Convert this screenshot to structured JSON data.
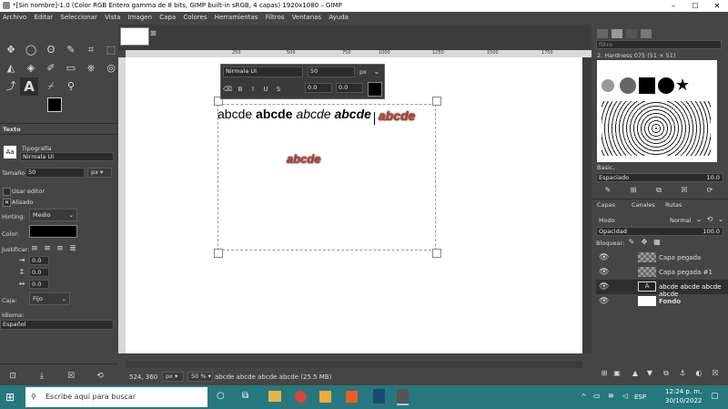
{
  "window": {
    "title": "*[Sin nombre]-1.0 (Color RGB Entero gamma de 8 bits, GIMP built-in sRGB, 4 capas) 1920x1080 – GIMP",
    "controls": [
      "–",
      "☐",
      "✕"
    ]
  },
  "menu": [
    "Archivo",
    "Editar",
    "Seleccionar",
    "Vista",
    "Imagen",
    "Capa",
    "Colores",
    "Herramientas",
    "Filtros",
    "Ventanas",
    "Ayuda"
  ],
  "tool_options": {
    "panel_title": "Texto",
    "tab_label": "Tipografía",
    "font_value": "Nirmala UI",
    "size_label": "Tamaño:",
    "size_value": "50",
    "size_unit": "px",
    "use_editor": "Usar editor",
    "antialias": "Alisado",
    "hinting_label": "Hinting:",
    "hinting_value": "Medio",
    "color_label": "Color:",
    "justify_label": "Justificar:",
    "indent_value": "0.0",
    "line_spacing_value": "0.0",
    "letter_spacing_value": "0.0",
    "box_label": "Caja:",
    "box_value": "Fijo",
    "language_label": "Idioma:",
    "language_value": "Español"
  },
  "ruler": {
    "ticks": [
      "250",
      "500",
      "750",
      "1000",
      "1250",
      "1500",
      "1750"
    ]
  },
  "text_toolbar": {
    "font": "Nirmala UI",
    "size": "50",
    "unit": "px",
    "baseline": "0.0",
    "kerning": "0.0"
  },
  "canvas_text": {
    "line_plain": "abcde",
    "line_bold": "abcde",
    "line_italic": "abcde",
    "line_bolditalic": "abcde",
    "styled1": "abcde",
    "styled2": "abcde"
  },
  "status": {
    "coords": "524, 360",
    "unit": "px",
    "zoom": "50 %",
    "info": "abcde abcde abcde abcde (25.5 MB)"
  },
  "brushes": {
    "filter_placeholder": "filtro",
    "brush_name": "2. Hardness 075 (51 × 51)",
    "preset": "Basic,",
    "spacing_label": "Espaciado",
    "spacing_value": "10.0"
  },
  "layers": {
    "tabs": [
      "Capas",
      "Canales",
      "Rutas"
    ],
    "mode_label": "Modo",
    "mode_value": "Normal",
    "opacity_label": "Opacidad",
    "opacity_value": "100.0",
    "lock_label": "Bloquear:",
    "items": [
      {
        "name": "Capa pegada",
        "bold": false
      },
      {
        "name": "Capa pegada #1",
        "bold": false
      },
      {
        "name": "abcde abcde abcde abcde",
        "bold": false,
        "selected": true
      },
      {
        "name": "Fondo",
        "bold": true
      }
    ]
  },
  "taskbar": {
    "search_placeholder": "Escribe aquí para buscar",
    "lang": "ESP",
    "time": "12:24 p. m.",
    "date": "30/10/2022"
  },
  "colors": {
    "accent_red": "#c0392b",
    "taskbar": "#27787e",
    "panel": "#454545"
  }
}
